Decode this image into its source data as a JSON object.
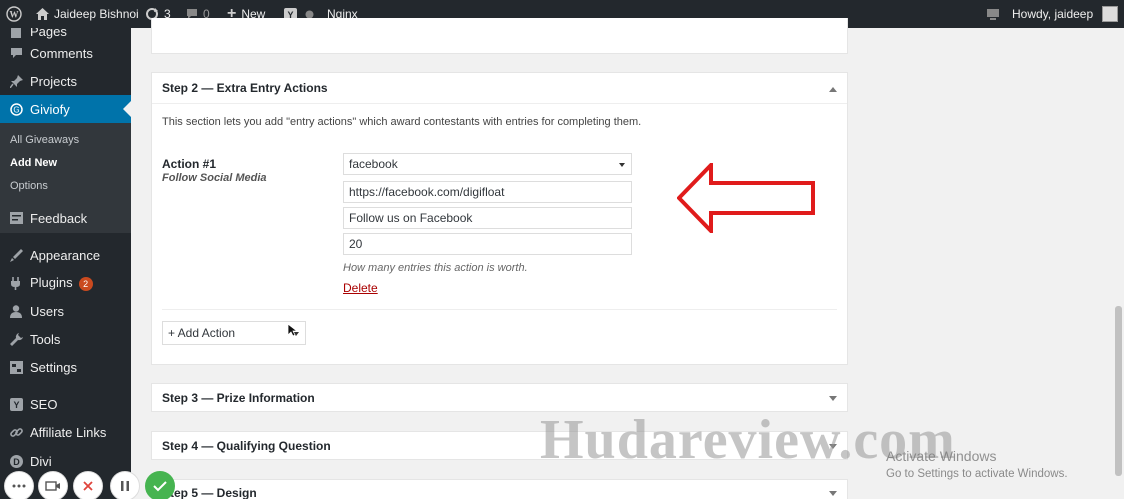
{
  "adminbar": {
    "site_name": "Jaideep Bishnoi",
    "updates_count": "3",
    "comments_count": "0",
    "new_label": "New",
    "nginx_label": "Nginx",
    "howdy": "Howdy, jaideep"
  },
  "sidebar": {
    "items": [
      {
        "label": "Pages",
        "icon": "pages-icon"
      },
      {
        "label": "Comments",
        "icon": "comments-icon"
      },
      {
        "label": "Projects",
        "icon": "pin-icon"
      },
      {
        "label": "Giviofy",
        "icon": "giviofy-icon"
      },
      {
        "label": "Feedback",
        "icon": "feedback-icon"
      },
      {
        "label": "Appearance",
        "icon": "appearance-icon"
      },
      {
        "label": "Plugins",
        "icon": "plugins-icon",
        "badge": "2"
      },
      {
        "label": "Users",
        "icon": "users-icon"
      },
      {
        "label": "Tools",
        "icon": "tools-icon"
      },
      {
        "label": "Settings",
        "icon": "settings-icon"
      },
      {
        "label": "SEO",
        "icon": "seo-icon"
      },
      {
        "label": "Affiliate Links",
        "icon": "link-icon"
      },
      {
        "label": "Divi",
        "icon": "divi-icon"
      }
    ],
    "submenu": [
      "All Giveaways",
      "Add New",
      "Options"
    ]
  },
  "step2": {
    "title": "Step 2 — Extra Entry Actions",
    "description": "This section lets you add \"entry actions\" which award contestants with entries for completing them.",
    "action_title": "Action #1",
    "action_subtitle": "Follow Social Media",
    "network_value": "facebook",
    "url_value": "https://facebook.com/digifloat",
    "label_value": "Follow us on Facebook",
    "entries_value": "20",
    "entries_help": "How many entries this action is worth.",
    "delete_label": "Delete",
    "add_action_label": "+ Add Action"
  },
  "step3": {
    "title": "Step 3 — Prize Information"
  },
  "step4": {
    "title": "Step 4 — Qualifying Question"
  },
  "step5": {
    "title": "Step 5 — Design"
  },
  "watermark": {
    "text": "Hudareview.com",
    "activate_line1": "Activate Windows",
    "activate_line2": "Go to Settings to activate Windows."
  },
  "colors": {
    "admin_bar": "#23282d",
    "sidebar_current": "#0073aa",
    "arrow": "#e01b1b",
    "delete_link": "#a00",
    "recorder_check": "#46b450"
  }
}
